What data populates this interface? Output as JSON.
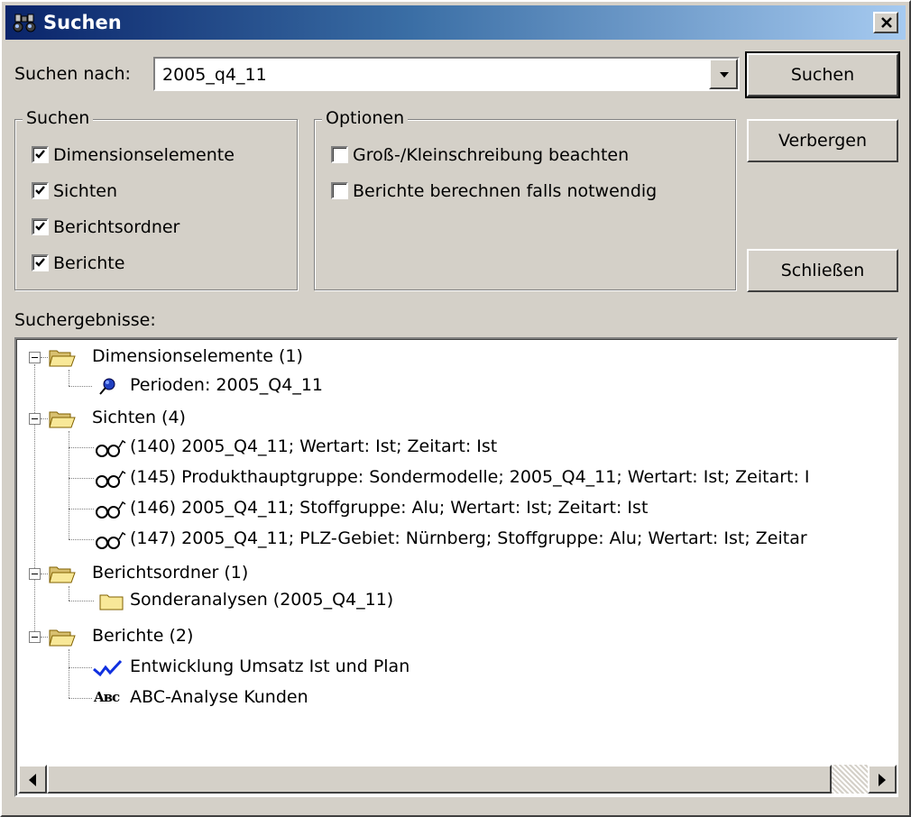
{
  "window": {
    "title": "Suchen",
    "title_icon": "binoculars-icon"
  },
  "search": {
    "label": "Suchen nach:",
    "value": "2005_q4_11"
  },
  "buttons": {
    "search": "Suchen",
    "hide": "Verbergen",
    "close": "Schließen"
  },
  "search_group": {
    "legend": "Suchen",
    "items": [
      {
        "label": "Dimensionselemente",
        "checked": true
      },
      {
        "label": "Sichten",
        "checked": true
      },
      {
        "label": "Berichtsordner",
        "checked": true
      },
      {
        "label": "Berichte",
        "checked": true
      }
    ]
  },
  "options_group": {
    "legend": "Optionen",
    "items": [
      {
        "label": "Groß-/Kleinschreibung beachten",
        "checked": false
      },
      {
        "label": "Berichte berechnen falls notwendig",
        "checked": false
      }
    ]
  },
  "results": {
    "label": "Suchergebnisse:",
    "nodes": [
      {
        "label": "Dimensionselemente (1)",
        "icon": "folder-open-icon",
        "children": [
          {
            "label": "Perioden: 2005_Q4_11",
            "icon": "dimension-pin-icon"
          }
        ]
      },
      {
        "label": "Sichten (4)",
        "icon": "folder-open-icon",
        "children": [
          {
            "label": "(140) 2005_Q4_11; Wertart: Ist; Zeitart: Ist",
            "icon": "glasses-icon"
          },
          {
            "label": "(145) Produkthauptgruppe: Sondermodelle; 2005_Q4_11; Wertart: Ist; Zeitart: I",
            "icon": "glasses-icon"
          },
          {
            "label": "(146) 2005_Q4_11; Stoffgruppe: Alu; Wertart: Ist; Zeitart: Ist",
            "icon": "glasses-icon"
          },
          {
            "label": "(147) 2005_Q4_11; PLZ-Gebiet: Nürnberg; Stoffgruppe: Alu; Wertart: Ist; Zeitar",
            "icon": "glasses-icon"
          }
        ]
      },
      {
        "label": "Berichtsordner (1)",
        "icon": "folder-open-icon",
        "children": [
          {
            "label": "Sonderanalysen (2005_Q4_11)",
            "icon": "folder-icon"
          }
        ]
      },
      {
        "label": "Berichte (2)",
        "icon": "folder-open-icon",
        "children": [
          {
            "label": "Entwicklung Umsatz Ist und Plan",
            "icon": "line-chart-icon"
          },
          {
            "label": "ABC-Analyse Kunden",
            "icon": "abc-icon",
            "icon_text": "Aʙc"
          }
        ]
      }
    ]
  }
}
